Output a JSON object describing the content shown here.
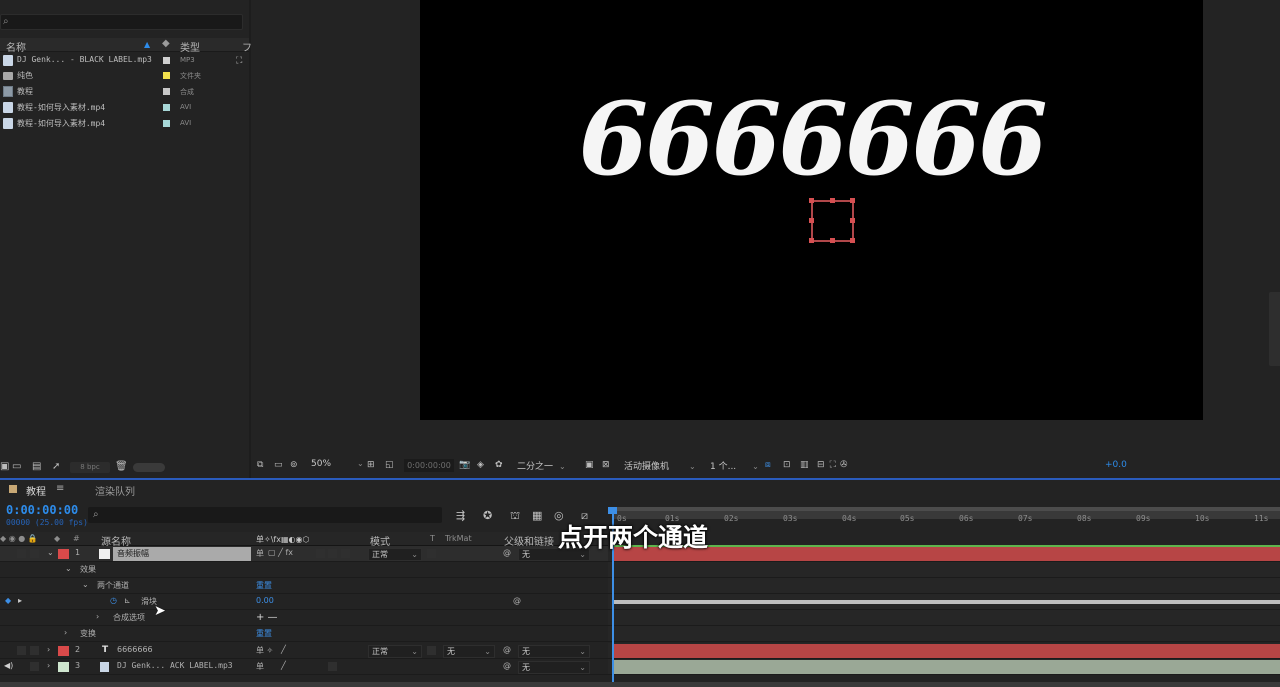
{
  "project": {
    "search_icon": "⌕",
    "columns": {
      "name": "名称",
      "type": "类型",
      "more": "フ"
    },
    "items": [
      {
        "name": "DJ Genk... - BLACK LABEL.mp3",
        "type": "MP3",
        "icon": "file-icon",
        "label_color": "#cfcfcf"
      },
      {
        "name": "纯色",
        "type": "文件夹",
        "icon": "folder-icon",
        "label_color": "#f2e04d"
      },
      {
        "name": "教程",
        "type": "合成",
        "icon": "composition-icon",
        "label_color": "#c8c8c8"
      },
      {
        "name": "教程-如何导入素材.mp4",
        "type": "AVI",
        "icon": "file-icon",
        "label_color": "#a8d8d8"
      },
      {
        "name": "教程-如何导入素材.mp4",
        "type": "AVI",
        "icon": "file-icon",
        "label_color": "#a8d8d8"
      }
    ],
    "bpc": "8 bpc"
  },
  "viewer": {
    "comp_text": "6666666",
    "zoom": "50%",
    "timecode": "0:00:00:00",
    "resolution": "二分之一",
    "camera": "活动摄像机",
    "views": "1 个...",
    "exposure": "+0.0"
  },
  "timeline": {
    "tab_active": "教程",
    "tab_menu": "≡",
    "tab_render": "渲染队列",
    "timecode": "0:00:00:00",
    "fps": "00000 (25.00 fps)",
    "search_icon": "⌕",
    "header": {
      "num": "#",
      "source_name": "源名称",
      "switches": "单✧\\fx▦◐◉⬡",
      "mode": "模式",
      "t": "T",
      "trkmat": "TrkMat",
      "parent": "父级和链接"
    },
    "ruler_ticks": [
      "0s",
      "01s",
      "02s",
      "03s",
      "04s",
      "05s",
      "06s",
      "07s",
      "08s",
      "09s",
      "10s",
      "11s"
    ],
    "layers": [
      {
        "num": "1",
        "name": "音频振幅",
        "label_color": "#d94a4a",
        "switch_text": "单",
        "mode": "正常",
        "parent": "无",
        "children": [
          {
            "name": "效果"
          },
          {
            "name": "两个通道",
            "value": "重置"
          },
          {
            "name": "滑块",
            "value": "0.00"
          },
          {
            "name": "合成选项",
            "value": "+ —"
          },
          {
            "name": "变换",
            "value": "重置"
          }
        ]
      },
      {
        "num": "2",
        "type_glyph": "T",
        "name": "6666666",
        "label_color": "#d94a4a",
        "switch_text": "单 ✧",
        "mode": "正常",
        "trkmat": "无",
        "parent": "无"
      },
      {
        "num": "3",
        "name": "DJ Genk... ACK LABEL.mp3",
        "label_color": "#cfe6cf",
        "switch_text": "单",
        "parent": "无"
      }
    ]
  },
  "subtitle": "点开两个通道",
  "colors": {
    "accent_blue": "#2d8ceb",
    "layer_red": "#d94a4a",
    "audio_track": "#9aa896",
    "mask_red": "#d65052"
  }
}
